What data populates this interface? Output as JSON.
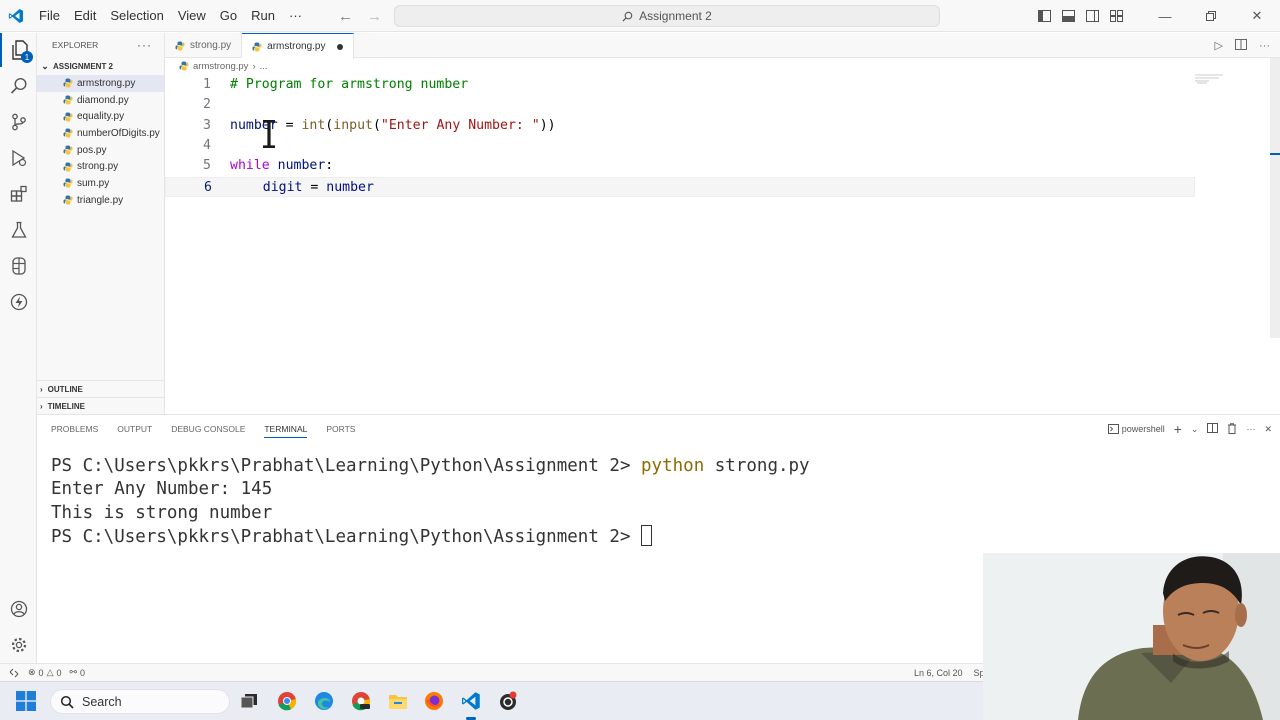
{
  "titlebar": {
    "menu": [
      "File",
      "Edit",
      "Selection",
      "View",
      "Go",
      "Run",
      "···"
    ],
    "command_center": "Assignment 2"
  },
  "explorer": {
    "header": "EXPLORER",
    "folder": "ASSIGNMENT 2",
    "files": [
      "armstrong.py",
      "diamond.py",
      "equality.py",
      "numberOfDigits.py",
      "pos.py",
      "strong.py",
      "sum.py",
      "triangle.py"
    ],
    "selected_file": "armstrong.py",
    "outline": "OUTLINE",
    "timeline": "TIMELINE",
    "badge_count": "1"
  },
  "tabs": [
    {
      "label": "strong.py",
      "active": false
    },
    {
      "label": "armstrong.py",
      "active": true,
      "dirty": true
    }
  ],
  "breadcrumb": {
    "file": "armstrong.py",
    "rest": "..."
  },
  "code_lines": [
    {
      "n": "1",
      "parts": [
        {
          "t": "# Program for armstrong number",
          "c": "comment"
        }
      ]
    },
    {
      "n": "2",
      "parts": []
    },
    {
      "n": "3",
      "parts": [
        {
          "t": "number",
          "c": "id"
        },
        {
          "t": " = ",
          "c": "plain"
        },
        {
          "t": "int",
          "c": "fn"
        },
        {
          "t": "(",
          "c": "plain"
        },
        {
          "t": "input",
          "c": "fn"
        },
        {
          "t": "(",
          "c": "plain"
        },
        {
          "t": "\"Enter Any Number: \"",
          "c": "str"
        },
        {
          "t": "))",
          "c": "plain"
        }
      ]
    },
    {
      "n": "4",
      "parts": []
    },
    {
      "n": "5",
      "parts": [
        {
          "t": "while",
          "c": "kw"
        },
        {
          "t": " ",
          "c": "plain"
        },
        {
          "t": "number",
          "c": "id"
        },
        {
          "t": ":",
          "c": "plain"
        }
      ]
    },
    {
      "n": "6",
      "parts": [
        {
          "t": "    ",
          "c": "plain"
        },
        {
          "t": "digit",
          "c": "id"
        },
        {
          "t": " = ",
          "c": "plain"
        },
        {
          "t": "number",
          "c": "id"
        }
      ]
    }
  ],
  "current_line": "6",
  "panel": {
    "tabs": [
      "PROBLEMS",
      "OUTPUT",
      "DEBUG CONSOLE",
      "TERMINAL",
      "PORTS"
    ],
    "active_tab": "TERMINAL",
    "shell": "powershell",
    "terminal": {
      "prompt": "PS C:\\Users\\pkkrs\\Prabhat\\Learning\\Python\\Assignment 2> ",
      "command_keyword": "python",
      "command_rest": " strong.py",
      "output_1": "Enter Any Number: 145",
      "output_2": "This is strong number",
      "prompt_2": "PS C:\\Users\\pkkrs\\Prabhat\\Learning\\Python\\Assignment 2> "
    }
  },
  "statusbar": {
    "errors": "0",
    "warnings": "0",
    "ports": "0",
    "position": "Ln 6, Col 20",
    "spaces": "Sp"
  },
  "taskbar": {
    "search_label": "Search"
  },
  "colors": {
    "accent": "#005fb8",
    "comment": "#008000",
    "keyword": "#af00db",
    "function": "#795e26",
    "string": "#a31515",
    "identifier": "#001080",
    "terminal_command": "#8c6c00"
  }
}
